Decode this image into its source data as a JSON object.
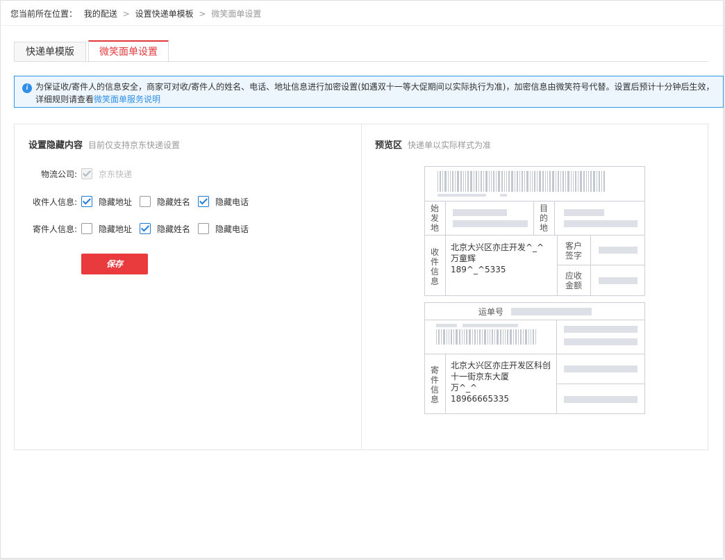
{
  "breadcrumb": {
    "prefix": "您当前所在位置：",
    "items": [
      "我的配送",
      "设置快递单模板"
    ],
    "current": "微笑面单设置",
    "separator": ">"
  },
  "tabs": [
    {
      "label": "快递单模版",
      "active": false
    },
    {
      "label": "微笑面单设置",
      "active": true
    }
  ],
  "notice": {
    "text": "为保证收/寄件人的信息安全，商家可对收/寄件人的姓名、电话、地址信息进行加密设置(如遇双十一等大促期间以实际执行为准)，加密信息由微笑符号代替。设置后预计十分钟后生效，详细规则请查看",
    "link": "微笑面单服务说明"
  },
  "settings": {
    "title": "设置隐藏内容",
    "subtitle": "目前仅支持京东快递设置",
    "logistics": {
      "label": "物流公司:",
      "option": "京东快递",
      "checked": true,
      "disabled": true
    },
    "receiver": {
      "label": "收件人信息:",
      "options": [
        {
          "label": "隐藏地址",
          "checked": true
        },
        {
          "label": "隐藏姓名",
          "checked": false
        },
        {
          "label": "隐藏电话",
          "checked": true
        }
      ]
    },
    "sender": {
      "label": "寄件人信息:",
      "options": [
        {
          "label": "隐藏地址",
          "checked": false
        },
        {
          "label": "隐藏姓名",
          "checked": true
        },
        {
          "label": "隐藏电话",
          "checked": false
        }
      ]
    },
    "save_label": "保存"
  },
  "preview": {
    "title": "预览区",
    "subtitle": "快递单以实际样式为准",
    "origin_label": "始发地",
    "dest_label": "目的地",
    "receiver_label": "收件信息",
    "receiver_lines": [
      "北京大兴区亦庄开发^_^",
      "万童辉",
      "189^_^5335"
    ],
    "customer_sign": "客户签字",
    "amount_label": "应收金额",
    "waybill_label": "运单号",
    "sender_label": "寄件信息",
    "sender_lines": [
      "北京大兴区亦庄开发区科创",
      "十一街京东大厦",
      "万^_^",
      "18966665335"
    ]
  },
  "colors": {
    "accent_red": "#e4393c",
    "save_red": "#e93b3d",
    "link_blue": "#2f8fe8",
    "notice_bg": "#edf6fd",
    "checkbox_blue": "#1e7bd9"
  }
}
